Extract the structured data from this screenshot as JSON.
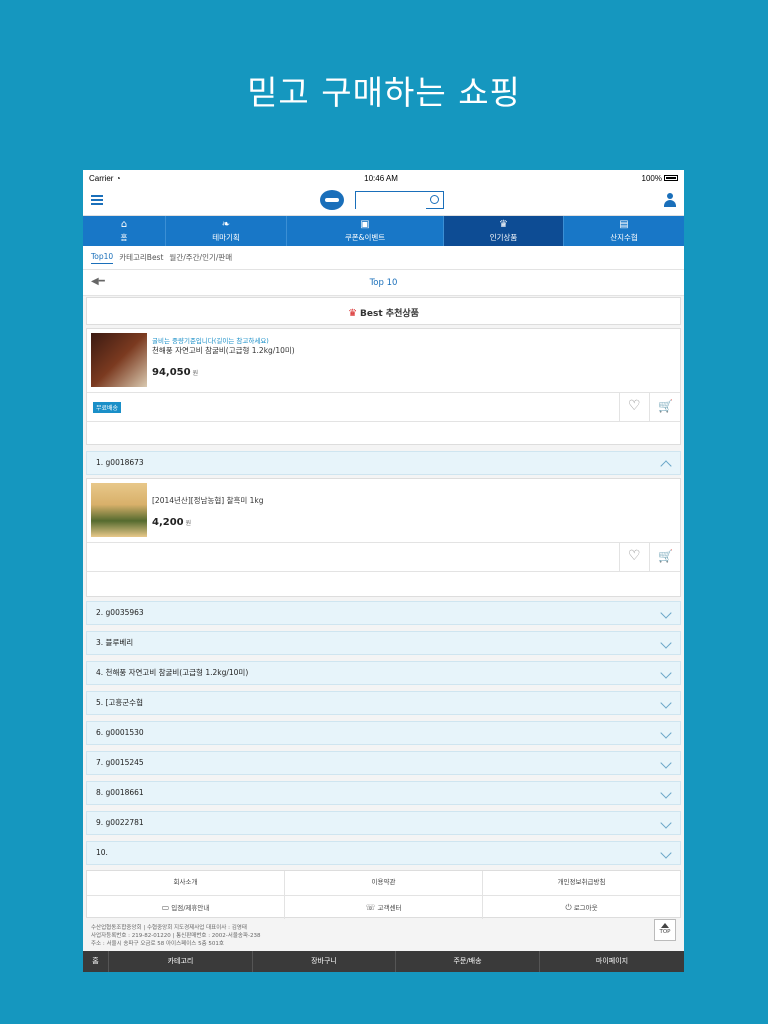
{
  "headline": "믿고 구매하는 쇼핑",
  "status": {
    "carrier": "Carrier",
    "time": "10:46 AM",
    "battery": "100%"
  },
  "nav": [
    {
      "label": "홈",
      "icon": "home-icon"
    },
    {
      "label": "테마기획",
      "icon": "fish-icon"
    },
    {
      "label": "쿠폰&이벤트",
      "icon": "gift-icon"
    },
    {
      "label": "인기상품",
      "icon": "trophy-icon"
    },
    {
      "label": "산지수협",
      "icon": "store-icon"
    }
  ],
  "subtabs": [
    "Top10",
    "카테고리Best",
    "월간/주간/인기/판매"
  ],
  "page_title": "Top 10",
  "best_title": "Best 추천상품",
  "best_product": {
    "subtitle": "굴비는 중량기준입니다(길이는 참고하세요)",
    "name": "천해풍 자연고비 참굴비(고급형 1.2kg/10미)",
    "price": "94,050",
    "unit": "원",
    "badge": "무료배송"
  },
  "product2": {
    "name": "[2014년산][정남농협] 찰흑미 1kg",
    "price": "4,200",
    "unit": "원"
  },
  "ranks": [
    "1. g0018673",
    "2. g0035963",
    "3. 블루베리",
    "4. 천해풍 자연고비 참굴비(고급형 1.2kg/10미)",
    "5. [고흥군수협",
    "6. g0001530",
    "7. g0015245",
    "8. g0018661",
    "9. g0022781",
    "10."
  ],
  "footer_links": {
    "row1": [
      "회사소개",
      "이용약관",
      "개인정보취급방침"
    ],
    "row2": [
      "입점/제휴안내",
      "고객센터",
      "로그아웃"
    ]
  },
  "company": {
    "line1": "수산업협동조합중앙회 | 수협중앙회 지도경제사업 대표이사 : 김영태",
    "line2": "사업자등록번호 : 219-82-01220 | 통신판매번호 : 2002-서울송파-238",
    "line3": "주소 : 서울시 송파구 오금로 58 아이스페이스 5층 501호"
  },
  "top_button": "TOP",
  "bottom_nav": [
    "홈",
    "카테고리",
    "장바구니",
    "주문/배송",
    "마이페이지"
  ]
}
